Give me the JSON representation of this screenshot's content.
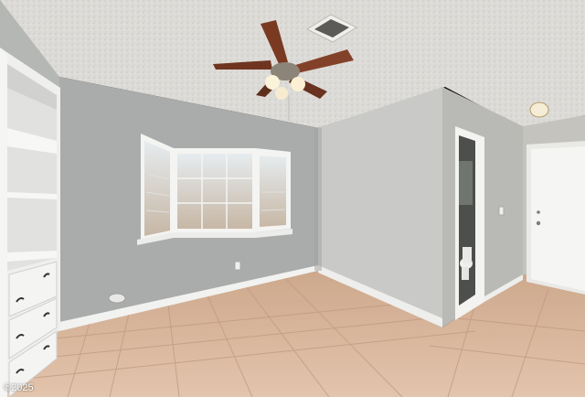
{
  "photo": {
    "watermark": "©2025",
    "colors": {
      "ceiling": "#dcdad6",
      "wall_left": "#aeb0ae",
      "wall_back": "#a7a9a8",
      "wall_right": "#c6c7c4",
      "floor_tile": "#d9b79c",
      "grout": "#c9a58a",
      "baseboard": "#f2f2f0",
      "fan_blade": "#7a3a22",
      "cabinet": "#f1f1ef",
      "window_frame": "#f4f4f2",
      "door": "#f5f5f3"
    }
  }
}
